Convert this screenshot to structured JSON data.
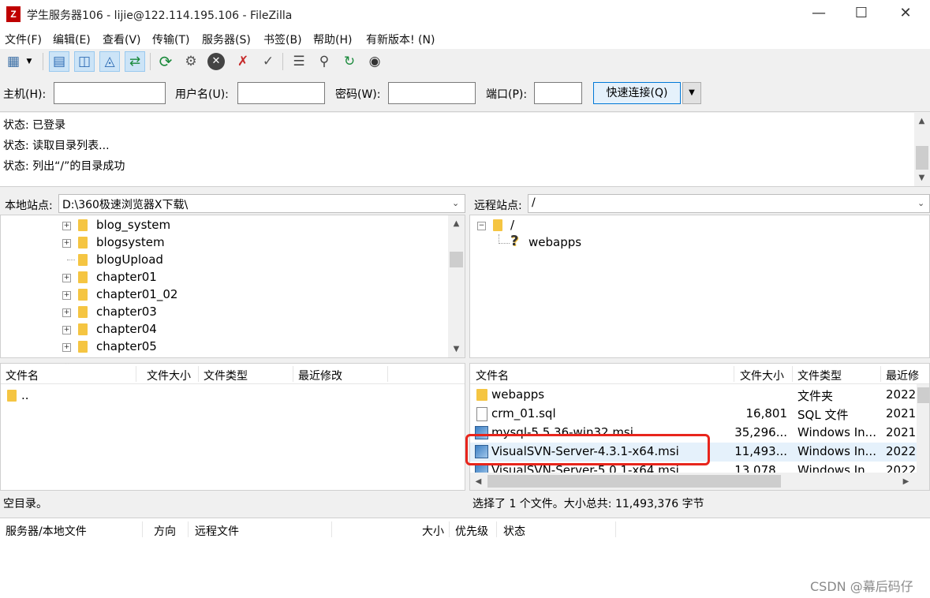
{
  "window": {
    "title": "学生服务器106 - lijie@122.114.195.106 - FileZilla",
    "app_icon_letter": "Z",
    "minimize": "—",
    "maximize": "☐",
    "close": "✕"
  },
  "menu": [
    "文件(F)",
    "编辑(E)",
    "查看(V)",
    "传输(T)",
    "服务器(S)",
    "书签(B)",
    "帮助(H)",
    "有新版本! (N)"
  ],
  "quickconnect": {
    "host_label": "主机(H):",
    "user_label": "用户名(U):",
    "pass_label": "密码(W):",
    "port_label": "端口(P):",
    "host_value": "",
    "user_value": "",
    "pass_value": "",
    "port_value": "",
    "connect_button": "快速连接(Q)"
  },
  "message_log": [
    "状态:  已登录",
    "状态:  读取目录列表...",
    "状态:  列出“/”的目录成功"
  ],
  "local": {
    "site_label": "本地站点:",
    "path": "D:\\360极速浏览器X下载\\",
    "tree": [
      {
        "name": "blog_system",
        "expandable": true
      },
      {
        "name": "blogsystem",
        "expandable": true
      },
      {
        "name": "blogUpload",
        "expandable": false
      },
      {
        "name": "chapter01",
        "expandable": true
      },
      {
        "name": "chapter01_02",
        "expandable": true
      },
      {
        "name": "chapter03",
        "expandable": true
      },
      {
        "name": "chapter04",
        "expandable": true
      },
      {
        "name": "chapter05",
        "expandable": true
      }
    ],
    "columns": [
      "文件名",
      "文件大小",
      "文件类型",
      "最近修改"
    ],
    "files": [
      ".."
    ],
    "status": "空目录。"
  },
  "remote": {
    "site_label": "远程站点:",
    "path": "/",
    "tree_root": "/",
    "tree_child": "webapps",
    "columns": [
      "文件名",
      "文件大小",
      "文件类型",
      "最近修"
    ],
    "files": [
      {
        "name": "webapps",
        "size": "",
        "type": "文件夹",
        "modified": "2022",
        "icon": "folder-icon"
      },
      {
        "name": "crm_01.sql",
        "size": "16,801",
        "type": "SQL 文件",
        "modified": "2021",
        "icon": "file-icon"
      },
      {
        "name": "mysql-5.5.36-win32.msi",
        "size": "35,296...",
        "type": "Windows In...",
        "modified": "2021",
        "icon": "msi-icon"
      },
      {
        "name": "VisualSVN-Server-4.3.1-x64.msi",
        "size": "11,493...",
        "type": "Windows In...",
        "modified": "2022",
        "icon": "msi-icon"
      },
      {
        "name": "VisualSVN-Server-5.0.1-x64.msi",
        "size": "13,078...",
        "type": "Windows In...",
        "modified": "2022",
        "icon": "msi-icon"
      }
    ],
    "status": "选择了 1 个文件。大小总共: 11,493,376 字节"
  },
  "queue": {
    "columns": [
      "服务器/本地文件",
      "方向",
      "远程文件",
      "大小",
      "优先级",
      "状态"
    ]
  },
  "watermark": "CSDN @幕后码仔",
  "colors": {
    "accent": "#0078d7",
    "highlight": "#e8251c",
    "folder": "#f5c542"
  }
}
